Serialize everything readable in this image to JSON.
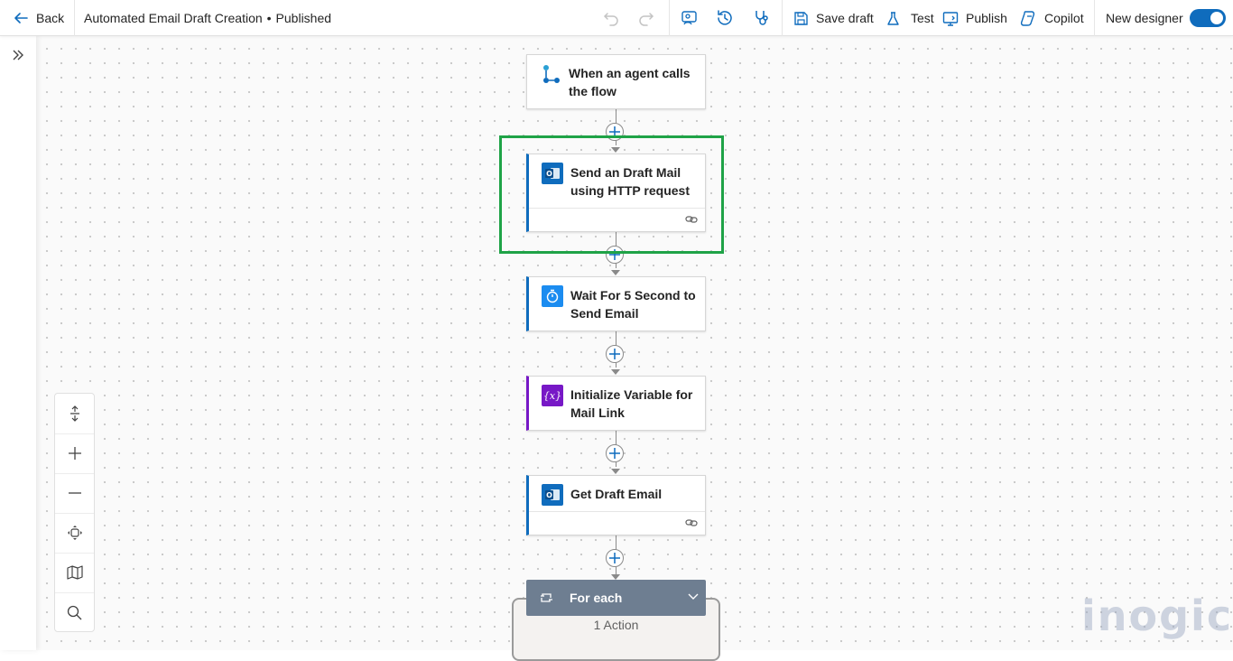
{
  "header": {
    "back_label": "Back",
    "flow_title": "Automated Email Draft Creation",
    "status_separator": "•",
    "status": "Published",
    "save_draft_label": "Save draft",
    "test_label": "Test",
    "publish_label": "Publish",
    "copilot_label": "Copilot",
    "new_designer_label": "New designer",
    "new_designer_enabled": true
  },
  "flow": {
    "trigger": {
      "title_line1": "When an agent calls",
      "title_line2": "the flow",
      "icon": "agent-trigger-icon"
    },
    "steps": [
      {
        "title_line1": "Send an Draft Mail",
        "title_line2": "using HTTP request",
        "icon": "outlook-icon",
        "accent": "#0f6cbd",
        "highlighted": true
      },
      {
        "title_line1": "Wait For 5 Second to",
        "title_line2": "Send Email",
        "icon": "timer-icon",
        "accent": "#0f6cbd"
      },
      {
        "title_line1": "Initialize Variable for",
        "title_line2": "Mail Link",
        "icon": "variable-icon",
        "accent": "#7718c6"
      },
      {
        "title_line1": "Get Draft Email",
        "title_line2": "",
        "icon": "outlook-icon",
        "accent": "#0f6cbd"
      }
    ],
    "foreach": {
      "title": "For each",
      "actions": "1 Action"
    }
  },
  "colors": {
    "highlight": "#1fa347",
    "accent_blue": "#0f6cbd",
    "accent_purple": "#7718c6",
    "foreach_header": "#6e7e91"
  },
  "watermark": "inogic"
}
